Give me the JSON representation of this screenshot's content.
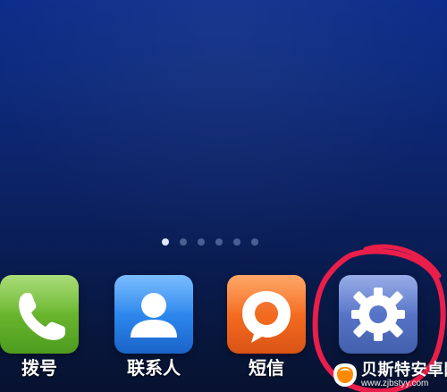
{
  "pager": {
    "count": 6,
    "active_index": 0
  },
  "dock": {
    "items": [
      {
        "label": "拨号",
        "icon": "phone-icon"
      },
      {
        "label": "联系人",
        "icon": "contacts-icon"
      },
      {
        "label": "短信",
        "icon": "message-icon"
      },
      {
        "label": "",
        "icon": "settings-icon"
      }
    ]
  },
  "overlay": {
    "annotation": "red-circle-highlight",
    "watermark_title": "贝斯特安卓网",
    "watermark_url": "www.zjbstyy.com"
  },
  "colors": {
    "background_top": "#0c2d8a",
    "background_bottom": "#07122f",
    "phone": "#67b52d",
    "contacts": "#2a84ea",
    "sms": "#f26a1f",
    "settings": "#5673c7",
    "highlight": "#ea1e4a"
  }
}
